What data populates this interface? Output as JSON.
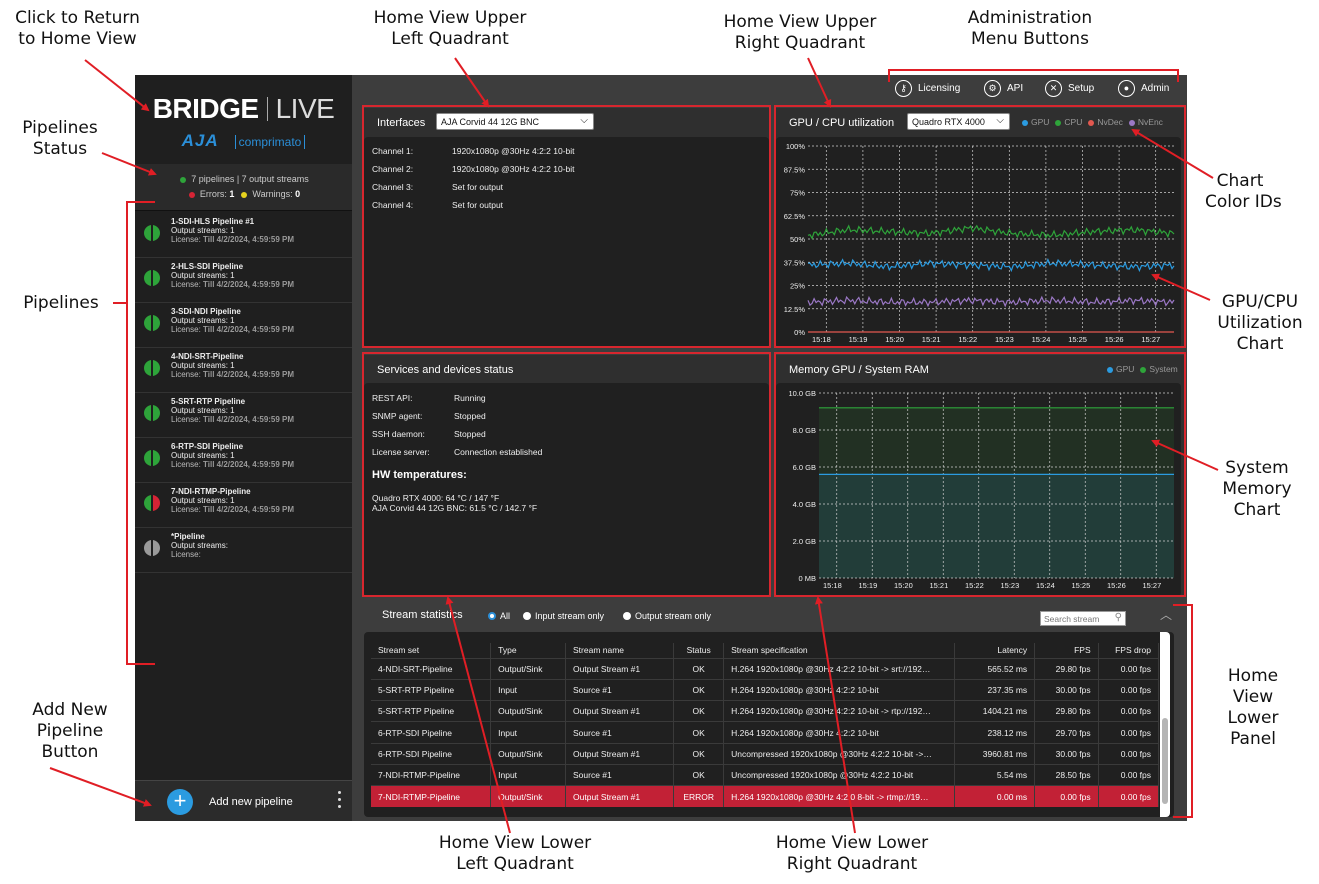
{
  "annotations": {
    "return_home": [
      "Click to Return",
      "to Home View"
    ],
    "upper_left": [
      "Home View Upper",
      "Left Quadrant"
    ],
    "upper_right": [
      "Home View Upper",
      "Right Quadrant"
    ],
    "admin_menu": [
      "Administration",
      "Menu Buttons"
    ],
    "pipelines_status": [
      "Pipelines",
      "Status"
    ],
    "chart_color_ids": [
      "Chart",
      "Color IDs"
    ],
    "pipelines": "Pipelines",
    "gpu_cpu_chart": [
      "GPU/CPU",
      "Utilization",
      "Chart"
    ],
    "system_memory": [
      "System",
      "Memory",
      "Chart"
    ],
    "lower_panel": [
      "Home",
      "View",
      "Lower",
      "Panel"
    ],
    "add_pipeline": [
      "Add New",
      "Pipeline",
      "Button"
    ],
    "lower_left": [
      "Home View Lower",
      "Left Quadrant"
    ],
    "lower_right": [
      "Home View Lower",
      "Right Quadrant"
    ]
  },
  "logo": {
    "brand": "BRIDGE",
    "product": "LIVE",
    "maker": "AJA",
    "partner": "comprimato"
  },
  "status": {
    "summary": "7 pipelines | 7 output streams",
    "errors_label": "Errors:",
    "errors_count": "1",
    "warnings_label": "Warnings:",
    "warnings_count": "0"
  },
  "colors": {
    "ok_green": "#2ea43a",
    "error_red": "#d62435",
    "warning_yellow": "#e6d21e",
    "idle_gray": "#9a9a9a",
    "accent_blue": "#2b9be0",
    "annotation_red": "#e01e25",
    "panel_border": "#d8262e"
  },
  "pipelines": [
    {
      "name": "1-SDI-HLS Pipeline #1",
      "streams_label": "Output streams:",
      "streams": "1",
      "license_label": "License:",
      "license": "Till 4/2/2024, 4:59:59 PM",
      "left": "#2ea43a",
      "right": "#2ea43a"
    },
    {
      "name": "2-HLS-SDI Pipeline",
      "streams_label": "Output streams:",
      "streams": "1",
      "license_label": "License:",
      "license": "Till 4/2/2024, 4:59:59 PM",
      "left": "#2ea43a",
      "right": "#2ea43a"
    },
    {
      "name": "3-SDI-NDI Pipeline",
      "streams_label": "Output streams:",
      "streams": "1",
      "license_label": "License:",
      "license": "Till 4/2/2024, 4:59:59 PM",
      "left": "#2ea43a",
      "right": "#2ea43a"
    },
    {
      "name": "4-NDI-SRT-Pipeline",
      "streams_label": "Output streams:",
      "streams": "1",
      "license_label": "License:",
      "license": "Till 4/2/2024, 4:59:59 PM",
      "left": "#2ea43a",
      "right": "#2ea43a"
    },
    {
      "name": "5-SRT-RTP Pipeline",
      "streams_label": "Output streams:",
      "streams": "1",
      "license_label": "License:",
      "license": "Till 4/2/2024, 4:59:59 PM",
      "left": "#2ea43a",
      "right": "#2ea43a"
    },
    {
      "name": "6-RTP-SDI Pipeline",
      "streams_label": "Output streams:",
      "streams": "1",
      "license_label": "License:",
      "license": "Till 4/2/2024, 4:59:59 PM",
      "left": "#2ea43a",
      "right": "#2ea43a"
    },
    {
      "name": "7-NDI-RTMP-Pipeline",
      "streams_label": "Output streams:",
      "streams": "1",
      "license_label": "License:",
      "license": "Till 4/2/2024, 4:59:59 PM",
      "left": "#2ea43a",
      "right": "#d62435"
    },
    {
      "name": "*Pipeline",
      "streams_label": "Output streams:",
      "streams": "",
      "license_label": "License:",
      "license": "",
      "left": "#9a9a9a",
      "right": "#9a9a9a"
    }
  ],
  "add_pipeline": {
    "icon": "+",
    "label": "Add new pipeline"
  },
  "admin_buttons": [
    {
      "icon": "key-icon",
      "glyph": "⚷",
      "label": "Licensing"
    },
    {
      "icon": "api-icon",
      "glyph": "⚙",
      "label": "API"
    },
    {
      "icon": "tools-icon",
      "glyph": "✕",
      "label": "Setup"
    },
    {
      "icon": "user-icon",
      "glyph": "●",
      "label": "Admin"
    }
  ],
  "interfaces": {
    "title": "Interfaces",
    "selected": "AJA Corvid 44 12G BNC",
    "channels": [
      {
        "label": "Channel 1:",
        "value": "1920x1080p @30Hz 4:2:2 10-bit"
      },
      {
        "label": "Channel 2:",
        "value": "1920x1080p @30Hz 4:2:2 10-bit"
      },
      {
        "label": "Channel 3:",
        "value": "Set for output"
      },
      {
        "label": "Channel 4:",
        "value": "Set for output"
      }
    ]
  },
  "utilization": {
    "title": "GPU / CPU utilization",
    "selected": "Quadro RTX 4000",
    "legend": [
      {
        "name": "GPU",
        "color": "#2b9be0"
      },
      {
        "name": "CPU",
        "color": "#2ea43a"
      },
      {
        "name": "NvDec",
        "color": "#e2584f"
      },
      {
        "name": "NvEnc",
        "color": "#9b78c6"
      }
    ]
  },
  "services": {
    "title": "Services and devices status",
    "items": [
      {
        "label": "REST API:",
        "value": "Running"
      },
      {
        "label": "SNMP agent:",
        "value": "Stopped"
      },
      {
        "label": "SSH daemon:",
        "value": "Stopped"
      },
      {
        "label": "License server:",
        "value": "Connection established"
      }
    ],
    "hw_title": "HW temperatures:",
    "temps": [
      {
        "label": "Quadro RTX 4000:",
        "value": "64 °C / 147 °F"
      },
      {
        "label": "AJA Corvid 44 12G BNC:",
        "value": "61.5 °C / 142.7 °F"
      }
    ]
  },
  "memory": {
    "title": "Memory GPU / System RAM",
    "legend": [
      {
        "name": "GPU",
        "color": "#2b9be0"
      },
      {
        "name": "System",
        "color": "#2ea43a"
      }
    ]
  },
  "chart_data": [
    {
      "type": "line",
      "title": "GPU / CPU utilization",
      "x": [
        "15:18",
        "15:19",
        "15:20",
        "15:21",
        "15:22",
        "15:23",
        "15:24",
        "15:25",
        "15:26",
        "15:27"
      ],
      "y_ticks": [
        "100%",
        "87.5%",
        "75%",
        "62.5%",
        "50%",
        "37.5%",
        "25%",
        "12.5%",
        "0%"
      ],
      "ylim": [
        0,
        100
      ],
      "grid": true,
      "series": [
        {
          "name": "CPU",
          "color": "#2ea43a",
          "values": [
            52,
            55,
            54,
            53,
            56,
            53,
            52,
            54,
            55,
            53
          ]
        },
        {
          "name": "GPU",
          "color": "#2b9be0",
          "values": [
            36,
            37,
            35,
            37,
            36,
            35,
            37,
            36,
            35,
            36
          ]
        },
        {
          "name": "NvEnc",
          "color": "#9b78c6",
          "values": [
            16,
            17,
            16,
            16,
            17,
            16,
            17,
            16,
            17,
            16
          ]
        },
        {
          "name": "NvDec",
          "color": "#e2584f",
          "values": [
            0,
            0,
            0,
            0,
            0,
            0,
            0,
            0,
            0,
            0
          ]
        }
      ]
    },
    {
      "type": "area",
      "title": "Memory GPU / System RAM",
      "x": [
        "15:18",
        "15:19",
        "15:20",
        "15:21",
        "15:22",
        "15:23",
        "15:24",
        "15:25",
        "15:26",
        "15:27"
      ],
      "y_ticks": [
        "10.0 GB",
        "8.0 GB",
        "6.0 GB",
        "4.0 GB",
        "2.0 GB",
        "0 MB"
      ],
      "ylim": [
        0,
        10
      ],
      "grid": true,
      "series": [
        {
          "name": "System",
          "color": "#2ea43a",
          "values": [
            9.2,
            9.2,
            9.2,
            9.2,
            9.2,
            9.2,
            9.2,
            9.2,
            9.2,
            9.2
          ]
        },
        {
          "name": "GPU",
          "color": "#2b9be0",
          "values": [
            5.6,
            5.6,
            5.6,
            5.6,
            5.6,
            5.6,
            5.6,
            5.6,
            5.6,
            5.6
          ]
        }
      ]
    }
  ],
  "stream_stats": {
    "title": "Stream statistics",
    "filters": [
      "All",
      "Input stream only",
      "Output stream only"
    ],
    "search_placeholder": "Search stream",
    "columns": [
      "Stream set",
      "Type",
      "Stream name",
      "Status",
      "Stream specification",
      "Latency",
      "FPS",
      "FPS drop"
    ],
    "rows": [
      [
        "4-NDI-SRT-Pipeline",
        "Output/Sink",
        "Output Stream #1",
        "OK",
        "H.264 1920x1080p @30Hz 4:2:2 10-bit -> srt://192…",
        "565.52 ms",
        "29.80 fps",
        "0.00 fps"
      ],
      [
        "5-SRT-RTP Pipeline",
        "Input",
        "Source #1",
        "OK",
        "H.264 1920x1080p @30Hz 4:2:2 10-bit",
        "237.35 ms",
        "30.00 fps",
        "0.00 fps"
      ],
      [
        "5-SRT-RTP Pipeline",
        "Output/Sink",
        "Output Stream #1",
        "OK",
        "H.264 1920x1080p @30Hz 4:2:2 10-bit -> rtp://192…",
        "1404.21 ms",
        "29.80 fps",
        "0.00 fps"
      ],
      [
        "6-RTP-SDI Pipeline",
        "Input",
        "Source #1",
        "OK",
        "H.264 1920x1080p @30Hz 4:2:2 10-bit",
        "238.12 ms",
        "29.70 fps",
        "0.00 fps"
      ],
      [
        "6-RTP-SDI Pipeline",
        "Output/Sink",
        "Output Stream #1",
        "OK",
        "Uncompressed 1920x1080p @30Hz 4:2:2 10-bit ->…",
        "3960.81 ms",
        "30.00 fps",
        "0.00 fps"
      ],
      [
        "7-NDI-RTMP-Pipeline",
        "Input",
        "Source #1",
        "OK",
        "Uncompressed 1920x1080p @30Hz 4:2:2 10-bit",
        "5.54 ms",
        "28.50 fps",
        "0.00 fps"
      ],
      [
        "7-NDI-RTMP-Pipeline",
        "Output/Sink",
        "Output Stream #1",
        "ERROR",
        "H.264 1920x1080p @30Hz 4:2:0 8-bit -> rtmp://19…",
        "0.00 ms",
        "0.00 fps",
        "0.00 fps"
      ]
    ]
  }
}
